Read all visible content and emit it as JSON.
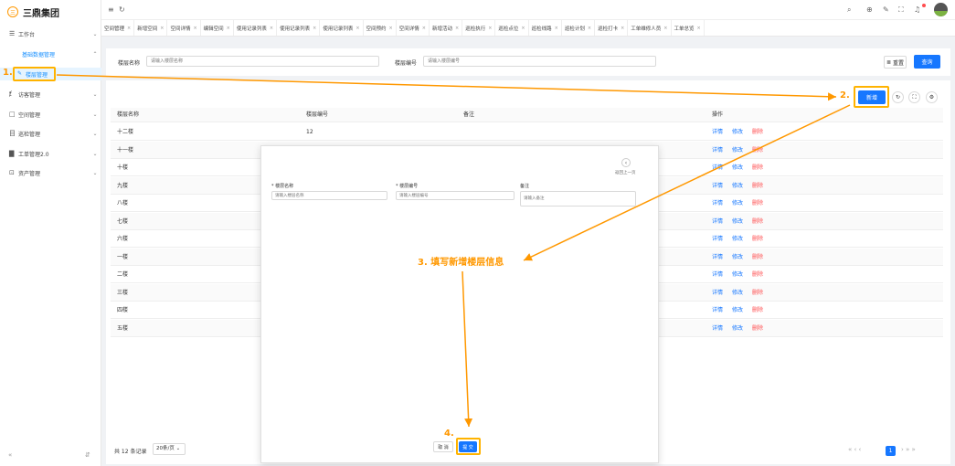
{
  "app": {
    "name": "三鼎集团",
    "logo_glyph": "三"
  },
  "sidebar": {
    "items": [
      {
        "label": "工作台",
        "icon": "☰",
        "arrow": "⌄"
      },
      {
        "label": "访客管理",
        "icon": "ⱦ",
        "arrow": "⌄"
      },
      {
        "label": "空间管理",
        "icon": "□",
        "arrow": "⌄"
      },
      {
        "label": "巡检管理",
        "icon": "目",
        "arrow": "⌄"
      },
      {
        "label": "工单管理2.0",
        "icon": "▇",
        "arrow": "⌄"
      },
      {
        "label": "资产管理",
        "icon": "⊡",
        "arrow": "⌄"
      }
    ],
    "submenu_title": "基础数据管理",
    "submenu_arrow": "⌃",
    "active_item": "楼层管理",
    "active_icon": "✎",
    "collapse_left": "«",
    "collapse_right": "⇵"
  },
  "topbar": {
    "menu_icon": "≡",
    "refresh_icon": "↻",
    "icons": [
      "⌕",
      "⊕",
      "✎",
      "⛶",
      "♫"
    ]
  },
  "tabs": [
    "空间管理",
    "新增空间",
    "空间详情",
    "编辑空间",
    "使用记录列表",
    "使用记录列表",
    "使用记录列表",
    "空间预约",
    "空间详情",
    "新增活动",
    "巡检执行",
    "巡检点位",
    "巡检线路",
    "巡检计划",
    "巡检打卡",
    "工单维修人员",
    "工单总览"
  ],
  "search": {
    "floor_name_label": "楼层名称",
    "floor_name_placeholder": "请输入楼层名称",
    "floor_no_label": "楼层编号",
    "floor_no_placeholder": "请输入楼层编号",
    "reset_icon": "≣",
    "reset_label": "重置",
    "query_label": "查询"
  },
  "toolbar": {
    "add_label": "新增",
    "refresh_icon": "↻",
    "fullscreen_icon": "⛶",
    "settings_icon": "⚙"
  },
  "table": {
    "headers": [
      "楼层名称",
      "楼层编号",
      "备注",
      "操作"
    ],
    "rows": [
      {
        "name": "十二楼",
        "no": "12"
      },
      {
        "name": "十一楼",
        "no": ""
      },
      {
        "name": "十楼",
        "no": ""
      },
      {
        "name": "九楼",
        "no": ""
      },
      {
        "name": "八楼",
        "no": ""
      },
      {
        "name": "七楼",
        "no": ""
      },
      {
        "name": "六楼",
        "no": ""
      },
      {
        "name": "一楼",
        "no": ""
      },
      {
        "name": "二楼",
        "no": ""
      },
      {
        "name": "三楼",
        "no": ""
      },
      {
        "name": "四楼",
        "no": ""
      },
      {
        "name": "五楼",
        "no": ""
      }
    ],
    "ops": {
      "detail": "详情",
      "edit": "修改",
      "delete": "删除"
    }
  },
  "footer": {
    "total": "共 12 条记录",
    "page_size": "20条/页",
    "current_page": "1",
    "pager_left": "«  ‹  ‹",
    "pager_right": "›  »  »"
  },
  "dialog": {
    "back_icon": "‹",
    "back_label": "返回上一页",
    "fields": [
      {
        "label": "* 楼层名称",
        "placeholder": "请输入楼层名称"
      },
      {
        "label": "* 楼层编号",
        "placeholder": "请输入楼层编号"
      },
      {
        "label": "备注",
        "placeholder": "请输入备注"
      }
    ],
    "cancel_label": "取 消",
    "submit_label": "提 交"
  },
  "annotations": {
    "step1": "1.",
    "step2": "2.",
    "step3": "3. 填写新增楼层信息",
    "step4": "4."
  },
  "colors": {
    "primary": "#1677ff",
    "annotation": "#ff9800",
    "danger": "#ff4d4f"
  }
}
